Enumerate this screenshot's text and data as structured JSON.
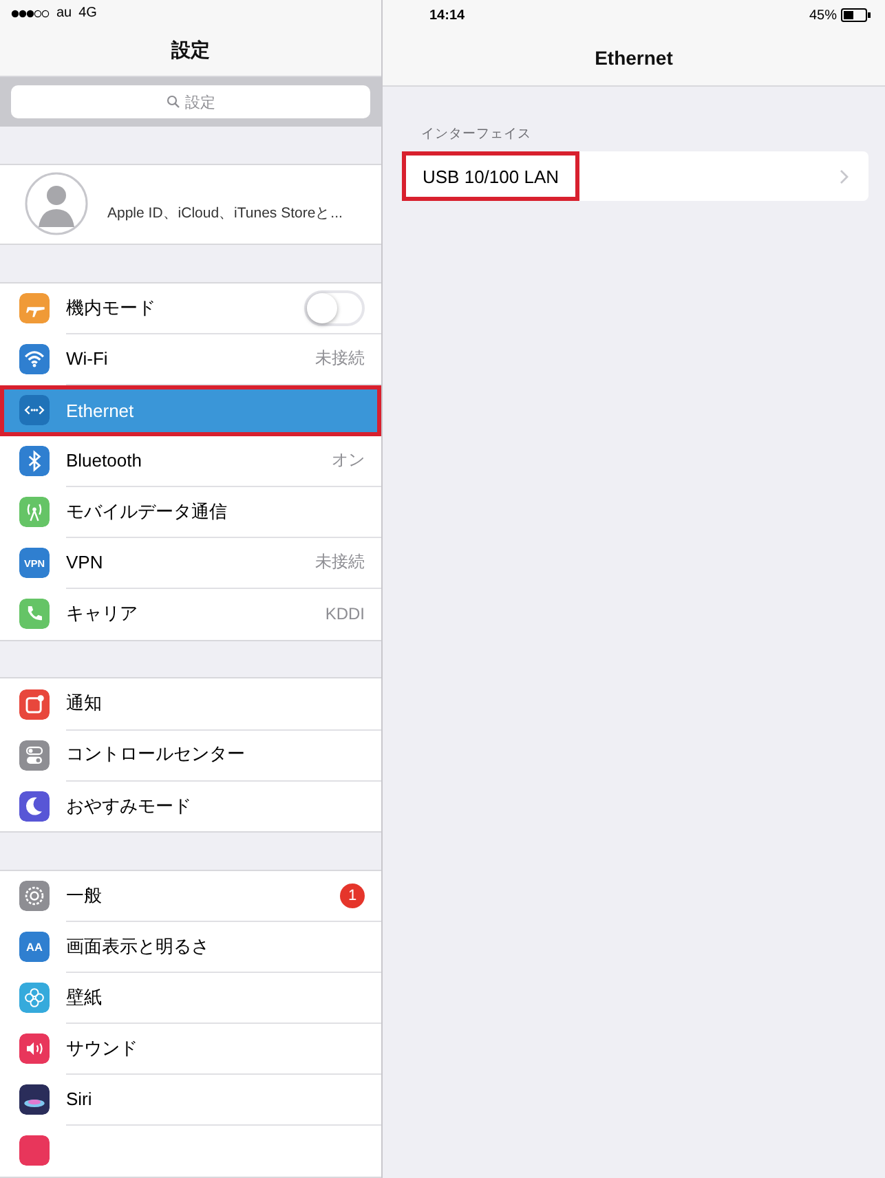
{
  "status_bar": {
    "carrier": "au",
    "network": "4G",
    "time": "14:14",
    "battery": "45%"
  },
  "sidebar": {
    "title": "設定",
    "search": {
      "placeholder": "設定"
    },
    "profile": {
      "subtitle": "Apple ID、iCloud、iTunes Storeと..."
    },
    "groups": [
      {
        "items": [
          {
            "kind": "toggle",
            "color": "#f09a37",
            "label": "機内モード",
            "on": false,
            "selected": false,
            "outlined": false
          },
          {
            "kind": "value",
            "color": "#2f7fd0",
            "label": "Wi-Fi",
            "value": "未接続",
            "selected": false,
            "outlined": false
          },
          {
            "kind": "plain",
            "color": "#1f72b8",
            "label": "Ethernet",
            "selected": true,
            "outlined": true
          },
          {
            "kind": "value",
            "color": "#2f7fd0",
            "label": "Bluetooth",
            "value": "オン",
            "selected": false,
            "outlined": false
          },
          {
            "kind": "plain",
            "color": "#65c466",
            "label": "モバイルデータ通信",
            "selected": false,
            "outlined": false
          },
          {
            "kind": "value",
            "color": "#2f7fd0",
            "icon_text": "VPN",
            "label": "VPN",
            "value": "未接続",
            "selected": false,
            "outlined": false
          },
          {
            "kind": "value",
            "color": "#65c466",
            "label": "キャリア",
            "value": "KDDI",
            "selected": false,
            "outlined": false
          }
        ]
      },
      {
        "items": [
          {
            "kind": "plain",
            "color": "#e8473c",
            "label": "通知",
            "selected": false,
            "outlined": false
          },
          {
            "kind": "plain",
            "color": "#8e8e93",
            "label": "コントロールセンター",
            "selected": false,
            "outlined": false
          },
          {
            "kind": "plain",
            "color": "#5856d6",
            "label": "おやすみモード",
            "selected": false,
            "outlined": false
          }
        ]
      },
      {
        "items": [
          {
            "kind": "badge",
            "color": "#8e8e93",
            "label": "一般",
            "badge": "1",
            "selected": false,
            "outlined": false
          },
          {
            "kind": "plain",
            "color": "#2f7fd0",
            "icon_text": "AA",
            "label": "画面表示と明るさ",
            "selected": false,
            "outlined": false
          },
          {
            "kind": "plain",
            "color": "#35aadc",
            "label": "壁紙",
            "selected": false,
            "outlined": false
          },
          {
            "kind": "plain",
            "color": "#e8365b",
            "label": "サウンド",
            "selected": false,
            "outlined": false
          },
          {
            "kind": "plain",
            "color": "#2a2d5a",
            "label": "Siri",
            "selected": false,
            "outlined": false
          },
          {
            "kind": "plain",
            "color": "#e8365b",
            "selected": false,
            "outlined": false
          }
        ]
      }
    ]
  },
  "detail": {
    "title": "Ethernet",
    "section_header": "インターフェイス",
    "rows": [
      {
        "label": "USB 10/100 LAN",
        "outlined": true
      }
    ]
  }
}
